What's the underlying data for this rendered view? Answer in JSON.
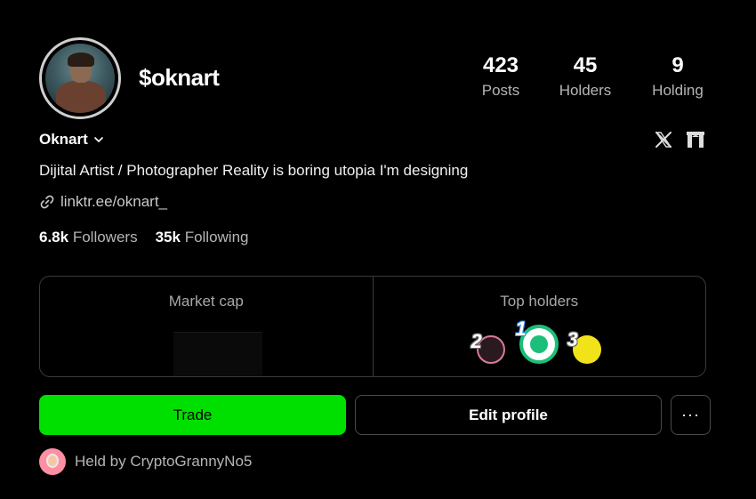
{
  "profile": {
    "handle": "$oknart",
    "name": "Oknart",
    "bio": "Dijital Artist / Photographer Reality is boring utopia I'm designing",
    "link": "linktr.ee/oknart_",
    "followers_count": "6.8k",
    "followers_label": "Followers",
    "following_count": "35k",
    "following_label": "Following"
  },
  "stats": [
    {
      "value": "423",
      "label": "Posts"
    },
    {
      "value": "45",
      "label": "Holders"
    },
    {
      "value": "9",
      "label": "Holding"
    }
  ],
  "social": [
    "x-icon",
    "gate-icon"
  ],
  "panel": {
    "market_cap_label": "Market cap",
    "top_holders_label": "Top holders",
    "top_holders": [
      {
        "rank": "2",
        "color": "#d87aa0"
      },
      {
        "rank": "1",
        "color": "#1bbf7a"
      },
      {
        "rank": "3",
        "color": "#f2e21a"
      }
    ]
  },
  "buttons": {
    "trade": "Trade",
    "edit": "Edit profile",
    "more": "···"
  },
  "held_by": "Held by CryptoGrannyNo5",
  "colors": {
    "accent": "#00e000",
    "background": "#000000",
    "muted": "#b5b5b5"
  }
}
